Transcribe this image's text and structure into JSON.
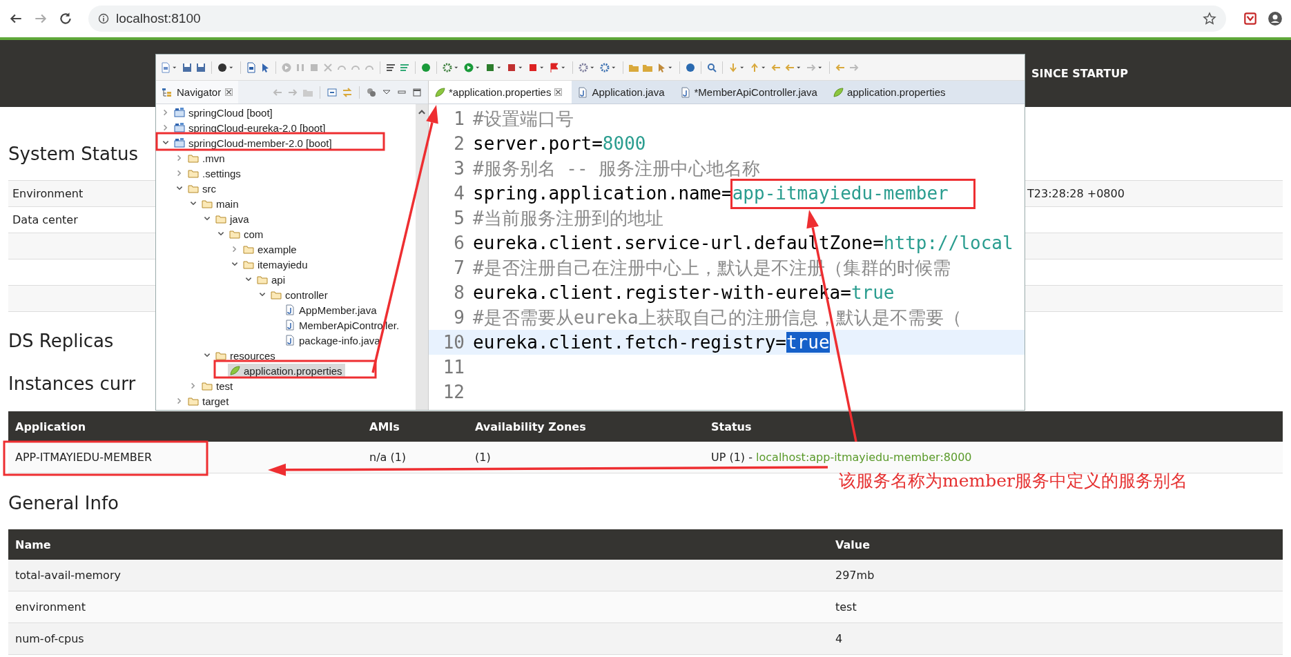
{
  "browser": {
    "url": "localhost:8100"
  },
  "eureka": {
    "header": {
      "nav_label": "SINCE STARTUP"
    },
    "system_status": {
      "title": "System Status",
      "rows": [
        {
          "label": "Environment",
          "value": "T23:28:28 +0800"
        },
        {
          "label": "Data center"
        }
      ]
    },
    "ds_replicas": {
      "title": "DS Replicas"
    },
    "instances": {
      "title": "Instances curr",
      "columns": [
        "Application",
        "AMIs",
        "Availability Zones",
        "Status"
      ],
      "rows": [
        {
          "application": "APP-ITMAYIEDU-MEMBER",
          "amis": "n/a (1)",
          "zones": "(1)",
          "status": "UP (1) -",
          "status_link": "localhost:app-itmayiedu-member:8000"
        }
      ]
    },
    "general_info": {
      "title": "General Info",
      "columns": [
        "Name",
        "Value"
      ],
      "rows": [
        {
          "name": "total-avail-memory",
          "value": "297mb"
        },
        {
          "name": "environment",
          "value": "test"
        },
        {
          "name": "num-of-cpus",
          "value": "4"
        }
      ]
    }
  },
  "eclipse": {
    "navigator": {
      "title": "Navigator",
      "items": [
        {
          "label": "springCloud [boot]",
          "kind": "project",
          "expanded": false,
          "selected": false
        },
        {
          "label": "springCloud-eureka-2.0 [boot]",
          "kind": "project",
          "expanded": false,
          "selected": false
        },
        {
          "label": "springCloud-member-2.0 [boot]",
          "kind": "project",
          "expanded": true,
          "selected": false,
          "children": [
            {
              "label": ".mvn",
              "kind": "folder",
              "expanded": false,
              "selected": false
            },
            {
              "label": ".settings",
              "kind": "folder",
              "expanded": false,
              "selected": false
            },
            {
              "label": "src",
              "kind": "folder",
              "expanded": true,
              "selected": false,
              "children": [
                {
                  "label": "main",
                  "kind": "folder",
                  "expanded": true,
                  "selected": false,
                  "children": [
                    {
                      "label": "java",
                      "kind": "folder",
                      "expanded": true,
                      "selected": false,
                      "children": [
                        {
                          "label": "com",
                          "kind": "folder",
                          "expanded": true,
                          "selected": false,
                          "children": [
                            {
                              "label": "example",
                              "kind": "folder",
                              "expanded": false,
                              "selected": false
                            },
                            {
                              "label": "itemayiedu",
                              "kind": "folder",
                              "expanded": true,
                              "selected": false,
                              "children": [
                                {
                                  "label": "api",
                                  "kind": "folder",
                                  "expanded": true,
                                  "selected": false,
                                  "children": [
                                    {
                                      "label": "controller",
                                      "kind": "folder",
                                      "expanded": true,
                                      "selected": false,
                                      "children": [
                                        {
                                          "label": "AppMember.java",
                                          "kind": "java",
                                          "selected": false
                                        },
                                        {
                                          "label": "MemberApiController.",
                                          "kind": "java",
                                          "selected": false
                                        },
                                        {
                                          "label": "package-info.java",
                                          "kind": "java",
                                          "selected": false
                                        }
                                      ]
                                    }
                                  ]
                                }
                              ]
                            }
                          ]
                        }
                      ]
                    },
                    {
                      "label": "resources",
                      "kind": "folder",
                      "expanded": true,
                      "selected": false,
                      "children": [
                        {
                          "label": "application.properties",
                          "kind": "properties",
                          "selected": true
                        }
                      ]
                    }
                  ]
                },
                {
                  "label": "test",
                  "kind": "folder",
                  "expanded": false,
                  "selected": false
                }
              ]
            },
            {
              "label": "target",
              "kind": "folder",
              "expanded": false,
              "selected": false
            }
          ]
        }
      ]
    },
    "editor": {
      "tabs": [
        {
          "label": "*application.properties",
          "kind": "properties",
          "selected": true
        },
        {
          "label": "Application.java",
          "kind": "java",
          "selected": false
        },
        {
          "label": "*MemberApiController.java",
          "kind": "java",
          "selected": false
        },
        {
          "label": "application.properties",
          "kind": "properties",
          "selected": false
        }
      ],
      "lines": [
        {
          "number": "1",
          "current": false,
          "segments": [
            {
              "kind": "comment",
              "text": "#设置端口号"
            }
          ]
        },
        {
          "number": "2",
          "current": false,
          "segments": [
            {
              "kind": "key",
              "text": "server.port="
            },
            {
              "kind": "value",
              "text": "8000"
            }
          ]
        },
        {
          "number": "3",
          "current": false,
          "segments": [
            {
              "kind": "comment",
              "text": "#服务别名 -- 服务注册中心地名称"
            }
          ]
        },
        {
          "number": "4",
          "current": false,
          "segments": [
            {
              "kind": "key",
              "text": "spring.application.name="
            },
            {
              "kind": "value",
              "text": "app-itmayiedu-member"
            }
          ]
        },
        {
          "number": "5",
          "current": false,
          "segments": [
            {
              "kind": "comment",
              "text": "#当前服务注册到的地址"
            }
          ]
        },
        {
          "number": "6",
          "current": false,
          "segments": [
            {
              "kind": "key",
              "text": "eureka.client.service-url.defaultZone="
            },
            {
              "kind": "value",
              "text": "http://local"
            }
          ]
        },
        {
          "number": "7",
          "current": false,
          "segments": [
            {
              "kind": "comment",
              "text": "#是否注册自己在注册中心上，默认是不注册（集群的时候需"
            }
          ]
        },
        {
          "number": "8",
          "current": false,
          "segments": [
            {
              "kind": "key",
              "text": "eureka.client.register-with-eureka="
            },
            {
              "kind": "value",
              "text": "true"
            }
          ]
        },
        {
          "number": "9",
          "current": false,
          "segments": [
            {
              "kind": "comment",
              "text": "#是否需要从eureka上获取自己的注册信息，默认是不需要（"
            }
          ]
        },
        {
          "number": "10",
          "current": true,
          "segments": [
            {
              "kind": "key",
              "text": "eureka.client.fetch-registry="
            },
            {
              "kind": "selection",
              "text": "true"
            }
          ]
        },
        {
          "number": "11",
          "current": false
        },
        {
          "number": "12",
          "current": false
        }
      ]
    }
  },
  "annotation": {
    "text": "该服务名称为member服务中定义的服务别名"
  }
}
